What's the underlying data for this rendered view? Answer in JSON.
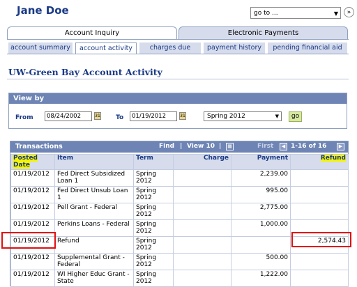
{
  "header": {
    "user_name": "Jane Doe",
    "goto_value": "go to ...",
    "goto_icon": "double-chevron-right-icon"
  },
  "tabs": [
    {
      "label": "Account Inquiry",
      "active": true
    },
    {
      "label": "Electronic Payments",
      "active": false
    }
  ],
  "subtabs": [
    {
      "label": "account summary",
      "active": false
    },
    {
      "label": "account activity",
      "active": true
    },
    {
      "label": "charges due",
      "active": false
    },
    {
      "label": "payment history",
      "active": false
    },
    {
      "label": "pending financial aid",
      "active": false
    }
  ],
  "page_title": "UW-Green Bay Account Activity",
  "view_by": {
    "heading": "View by",
    "from_label": "From",
    "from_value": "08/24/2002",
    "to_label": "To",
    "to_value": "01/19/2012",
    "term_value": "Spring 2012",
    "go_label": "go",
    "calendar_icon_text": "31"
  },
  "transactions": {
    "title": "Transactions",
    "find_label": "Find",
    "view_label": "View 10",
    "first_label": "First",
    "range_label": "1-16 of 16",
    "columns": [
      "Posted Date",
      "Item",
      "Term",
      "Charge",
      "Payment",
      "Refund"
    ],
    "rows": [
      {
        "date": "01/19/2012",
        "item": "Fed Direct Subsidized Loan 1",
        "term": "Spring 2012",
        "charge": "",
        "payment": "2,239.00",
        "refund": ""
      },
      {
        "date": "01/19/2012",
        "item": "Fed Direct Unsub Loan 1",
        "term": "Spring 2012",
        "charge": "",
        "payment": "995.00",
        "refund": ""
      },
      {
        "date": "01/19/2012",
        "item": "Pell Grant - Federal",
        "term": "Spring 2012",
        "charge": "",
        "payment": "2,775.00",
        "refund": ""
      },
      {
        "date": "01/19/2012",
        "item": "Perkins Loans - Federal",
        "term": "Spring 2012",
        "charge": "",
        "payment": "1,000.00",
        "refund": ""
      },
      {
        "date": "01/19/2012",
        "item": "Refund",
        "term": "Spring 2012",
        "charge": "",
        "payment": "",
        "refund": "2,574.43"
      },
      {
        "date": "01/19/2012",
        "item": "Supplemental Grant - Federal",
        "term": "Spring 2012",
        "charge": "",
        "payment": "500.00",
        "refund": ""
      },
      {
        "date": "01/19/2012",
        "item": "WI Higher Educ Grant - State",
        "term": "Spring 2012",
        "charge": "",
        "payment": "1,222.00",
        "refund": ""
      }
    ]
  },
  "colors": {
    "brand_blue": "#1a3a86",
    "header_bar": "#6d84b4",
    "highlight_yellow": "#f5f500",
    "annotation_red": "#e01010"
  }
}
